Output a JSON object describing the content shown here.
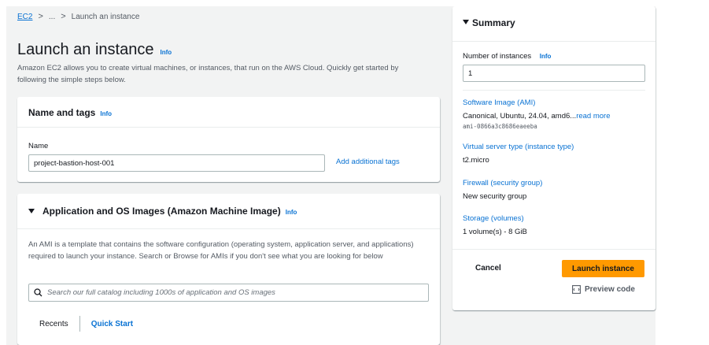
{
  "breadcrumb": {
    "root": "EC2",
    "ellipsis": "...",
    "current": "Launch an instance"
  },
  "page": {
    "title": "Launch an instance",
    "title_info": "Info",
    "description": "Amazon EC2 allows you to create virtual machines, or instances, that run on the AWS Cloud. Quickly get started by following the simple steps below."
  },
  "name_tags": {
    "header": "Name and tags",
    "info": "Info",
    "name_label": "Name",
    "name_value": "project-bastion-host-001",
    "add_tags": "Add additional tags"
  },
  "ami": {
    "header": "Application and OS Images (Amazon Machine Image)",
    "info": "Info",
    "description": "An AMI is a template that contains the software configuration (operating system, application server, and applications) required to launch your instance. Search or Browse for AMIs if you don't see what you are looking for below",
    "search_placeholder": "Search our full catalog including 1000s of application and OS images",
    "tabs": [
      "Recents",
      "Quick Start"
    ]
  },
  "summary": {
    "header": "Summary",
    "instances_label": "Number of instances",
    "instances_info": "Info",
    "instances_value": "1",
    "software_image_label": "Software Image (AMI)",
    "software_image_value": "Canonical, Ubuntu, 24.04, amd6...",
    "read_more": "read more",
    "ami_id": "ami-0866a3c8686eaeeba",
    "server_type_label": "Virtual server type (instance type)",
    "server_type_value": "t2.micro",
    "firewall_label": "Firewall (security group)",
    "firewall_value": "New security group",
    "storage_label": "Storage (volumes)",
    "storage_value": "1 volume(s) - 8 GiB",
    "cancel": "Cancel",
    "launch": "Launch instance",
    "preview": "Preview code"
  },
  "colors": {
    "accent": "#0972d3",
    "launch": "#ff9900",
    "background": "#f2f3f3"
  }
}
